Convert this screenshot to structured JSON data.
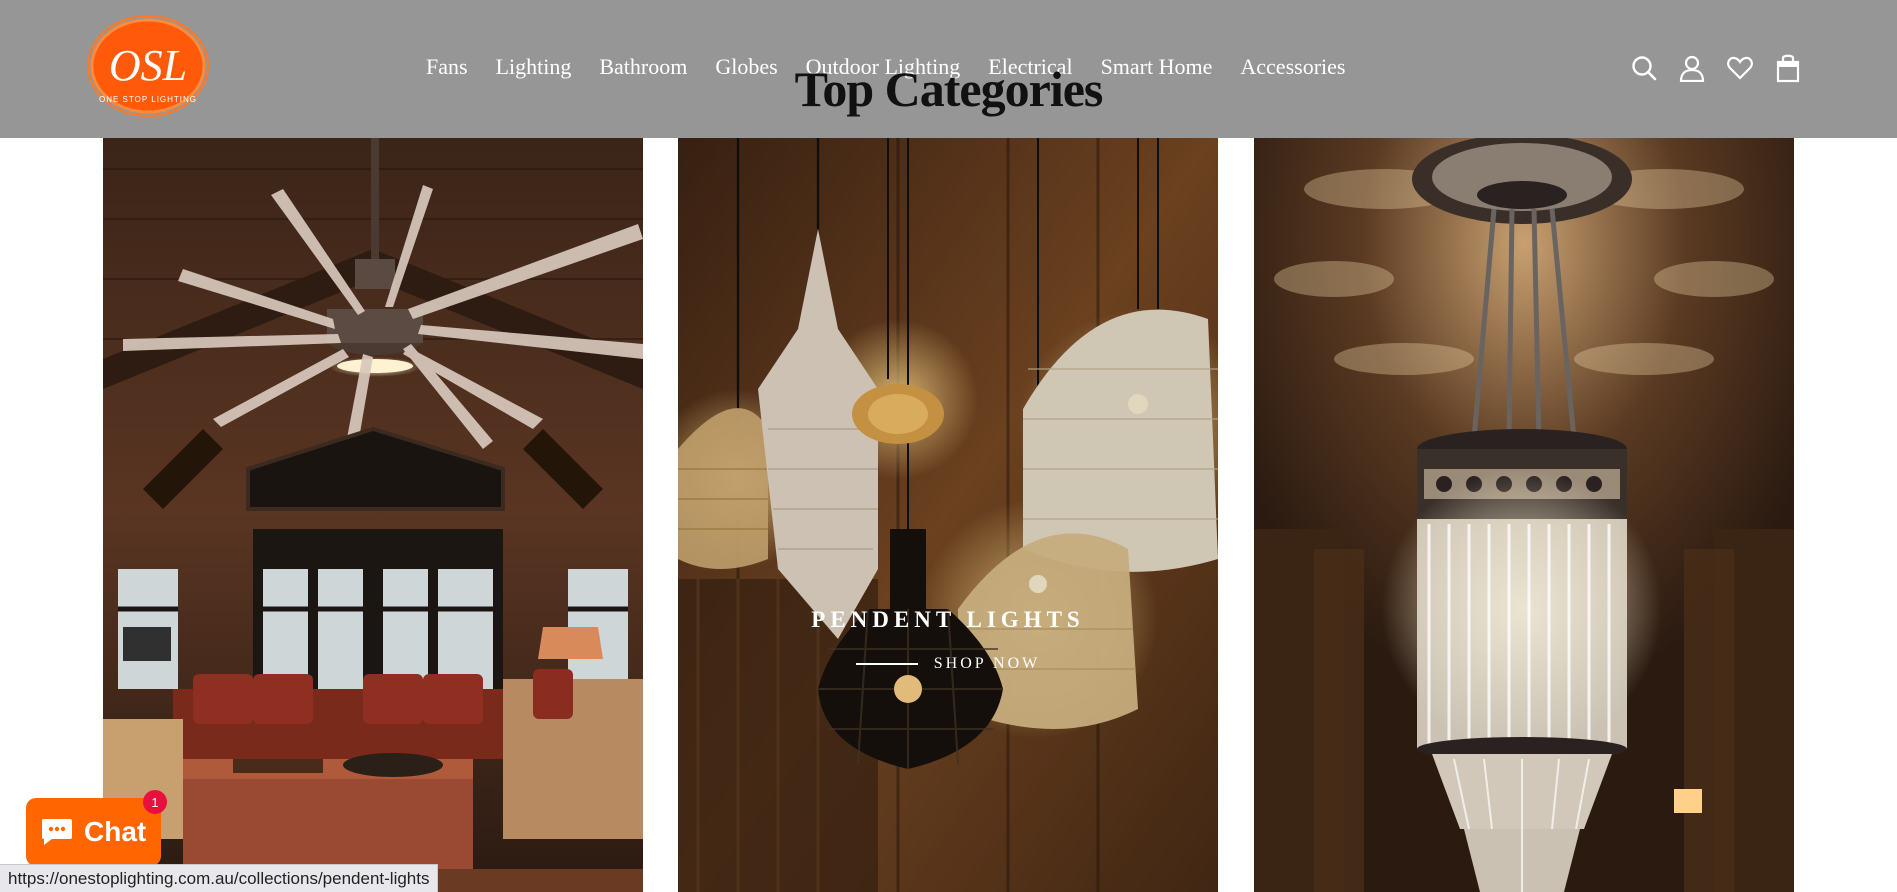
{
  "brand": {
    "logo_text": "OSL",
    "logo_subtext": "ONE STOP LIGHTING",
    "color": "#ff5a0a"
  },
  "nav": {
    "items": [
      "Fans",
      "Lighting",
      "Bathroom",
      "Globes",
      "Outdoor Lighting",
      "Electrical",
      "Smart Home",
      "Accessories"
    ]
  },
  "header_icons": [
    "search-icon",
    "account-icon",
    "wishlist-heart-icon",
    "cart-bag-icon"
  ],
  "section": {
    "title": "Top Categories"
  },
  "categories": [
    {
      "image": "ceiling-fan-living-room",
      "title": "",
      "link": ""
    },
    {
      "image": "pendant-lights",
      "title": "PENDENT LIGHTS",
      "link": "SHOP NOW"
    },
    {
      "image": "crystal-chandelier",
      "title": "",
      "link": ""
    }
  ],
  "chat": {
    "label": "Chat",
    "badge_count": "1",
    "color": "#ff6600"
  },
  "status_bar": {
    "url": "https://onestoplighting.com.au/collections/pendent-lights"
  },
  "colors": {
    "header_bg": "#969696",
    "accent": "#ff6600",
    "badge": "#e8113d"
  }
}
